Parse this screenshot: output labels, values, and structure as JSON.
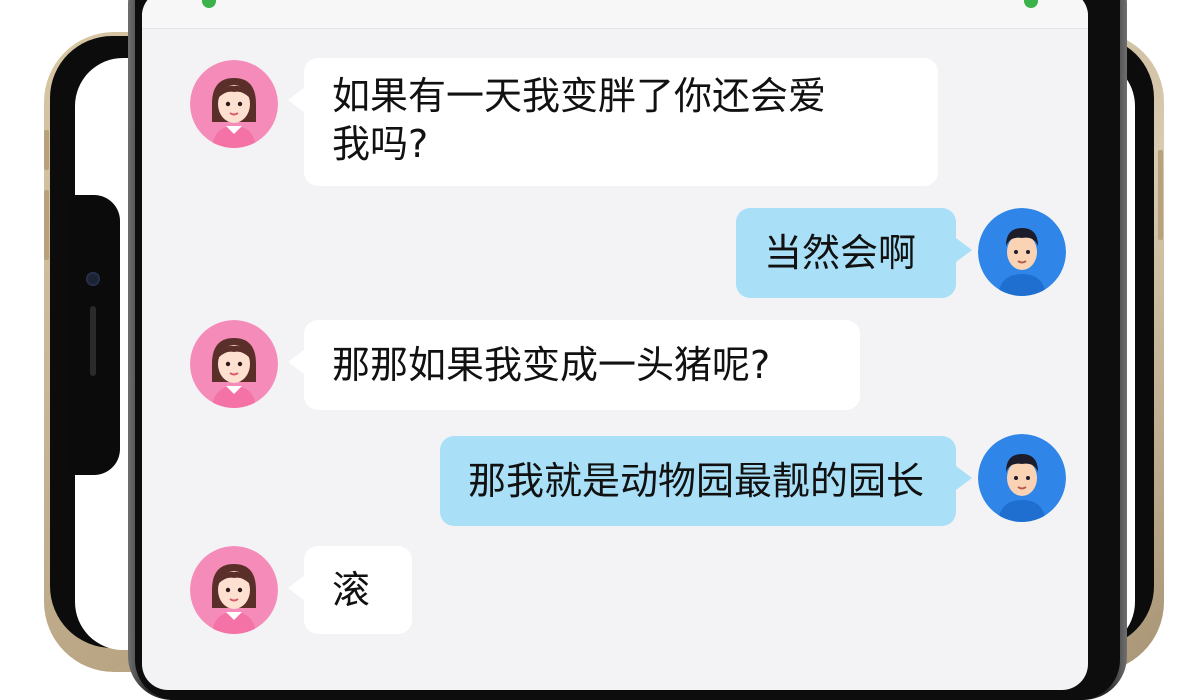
{
  "chat": {
    "messages": [
      {
        "sender": "girl",
        "side": "left",
        "text_line1": "如果有一天我变胖了你还会爱",
        "text_line2": "我吗?"
      },
      {
        "sender": "boy",
        "side": "right",
        "text": "当然会啊"
      },
      {
        "sender": "girl",
        "side": "left",
        "text": "那那如果我变成一头猪呢?"
      },
      {
        "sender": "boy",
        "side": "right",
        "text": "那我就是动物园最靓的园长"
      },
      {
        "sender": "girl",
        "side": "left",
        "text": "滚"
      }
    ]
  },
  "colors": {
    "sent_bubble": "#a9e0f7",
    "received_bubble": "#ffffff",
    "chat_background": "#f3f3f6",
    "girl_avatar_bg": "#f58bb8",
    "boy_avatar_bg": "#2f86e8"
  }
}
